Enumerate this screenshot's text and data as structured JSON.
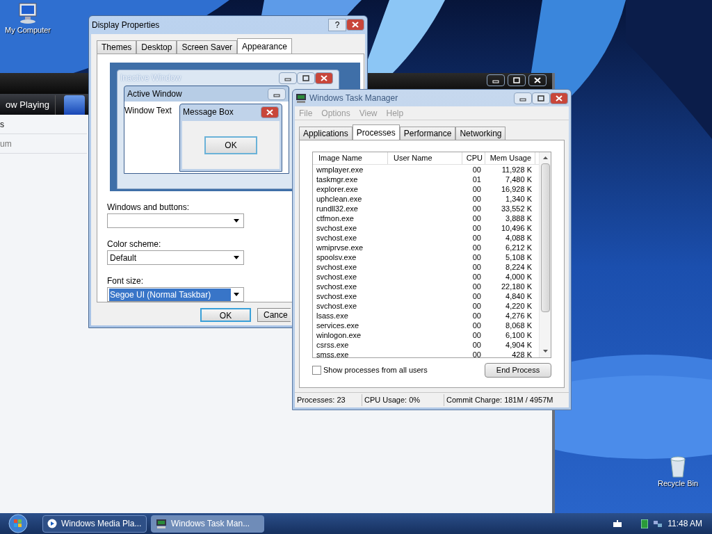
{
  "desktop_icons": [
    {
      "kind": "computer",
      "label": "My Computer"
    },
    {
      "kind": "recycle",
      "label": "Recycle Bin"
    }
  ],
  "media_player": {
    "tabs": [
      {
        "label": "ow Playing",
        "selected": false
      },
      {
        "selected": true
      }
    ],
    "list_items": [
      "s",
      "um"
    ]
  },
  "display_properties": {
    "title": "Display Properties",
    "help_label": "?",
    "tabs": [
      {
        "label": "Themes",
        "selected": false
      },
      {
        "label": "Desktop",
        "selected": false
      },
      {
        "label": "Screen Saver",
        "selected": false
      },
      {
        "label": "Appearance",
        "selected": true
      }
    ],
    "preview": {
      "inactive_title": "Inactive Window",
      "active_title": "Active Window",
      "window_text": "Window Text",
      "message_title": "Message Box",
      "message_button": "OK"
    },
    "fields": [
      {
        "label": "Windows and buttons:",
        "highlighted": false
      },
      {
        "label": "Color scheme:",
        "value": "Default",
        "highlighted": false
      },
      {
        "label": "Font size:",
        "value": "Segoe UI (Normal Taskbar)",
        "highlighted": true
      }
    ],
    "buttons": [
      "OK",
      "Cance"
    ]
  },
  "task_manager": {
    "title": "Windows Task Manager",
    "menu": [
      "File",
      "Options",
      "View",
      "Help"
    ],
    "tabs": [
      {
        "label": "Applications",
        "selected": false
      },
      {
        "label": "Processes",
        "selected": true
      },
      {
        "label": "Performance",
        "selected": false
      },
      {
        "label": "Networking",
        "selected": false
      }
    ],
    "columns": [
      "Image Name",
      "User Name",
      "CPU",
      "Mem Usage"
    ],
    "rows": [
      {
        "name": "wmplayer.exe",
        "cpu": "00",
        "mem": "11,928 K"
      },
      {
        "name": "taskmgr.exe",
        "cpu": "01",
        "mem": "7,480 K"
      },
      {
        "name": "explorer.exe",
        "cpu": "00",
        "mem": "16,928 K"
      },
      {
        "name": "uphclean.exe",
        "cpu": "00",
        "mem": "1,340 K"
      },
      {
        "name": "rundll32.exe",
        "cpu": "00",
        "mem": "33,552 K"
      },
      {
        "name": "ctfmon.exe",
        "cpu": "00",
        "mem": "3,888 K"
      },
      {
        "name": "svchost.exe",
        "cpu": "00",
        "mem": "10,496 K"
      },
      {
        "name": "svchost.exe",
        "cpu": "00",
        "mem": "4,088 K"
      },
      {
        "name": "wmiprvse.exe",
        "cpu": "00",
        "mem": "6,212 K"
      },
      {
        "name": "spoolsv.exe",
        "cpu": "00",
        "mem": "5,108 K"
      },
      {
        "name": "svchost.exe",
        "cpu": "00",
        "mem": "8,224 K"
      },
      {
        "name": "svchost.exe",
        "cpu": "00",
        "mem": "4,000 K"
      },
      {
        "name": "svchost.exe",
        "cpu": "00",
        "mem": "22,180 K"
      },
      {
        "name": "svchost.exe",
        "cpu": "00",
        "mem": "4,840 K"
      },
      {
        "name": "svchost.exe",
        "cpu": "00",
        "mem": "4,220 K"
      },
      {
        "name": "lsass.exe",
        "cpu": "00",
        "mem": "4,276 K"
      },
      {
        "name": "services.exe",
        "cpu": "00",
        "mem": "8,068 K"
      },
      {
        "name": "winlogon.exe",
        "cpu": "00",
        "mem": "6,100 K"
      },
      {
        "name": "csrss.exe",
        "cpu": "00",
        "mem": "4,904 K"
      },
      {
        "name": "smss.exe",
        "cpu": "00",
        "mem": "428 K"
      }
    ],
    "show_all": {
      "label": "Show processes from all users",
      "checked": false
    },
    "end_button": "End Process",
    "status": [
      "Processes: 23",
      "CPU Usage: 0%",
      "Commit Charge: 181M / 4957M"
    ]
  },
  "taskbar": {
    "buttons": [
      {
        "kind": "player",
        "label": "Windows Media Pla...",
        "selected": false
      },
      {
        "kind": "monitor",
        "label": "Windows Task Man...",
        "selected": true
      }
    ],
    "clock": "11:48 AM"
  }
}
